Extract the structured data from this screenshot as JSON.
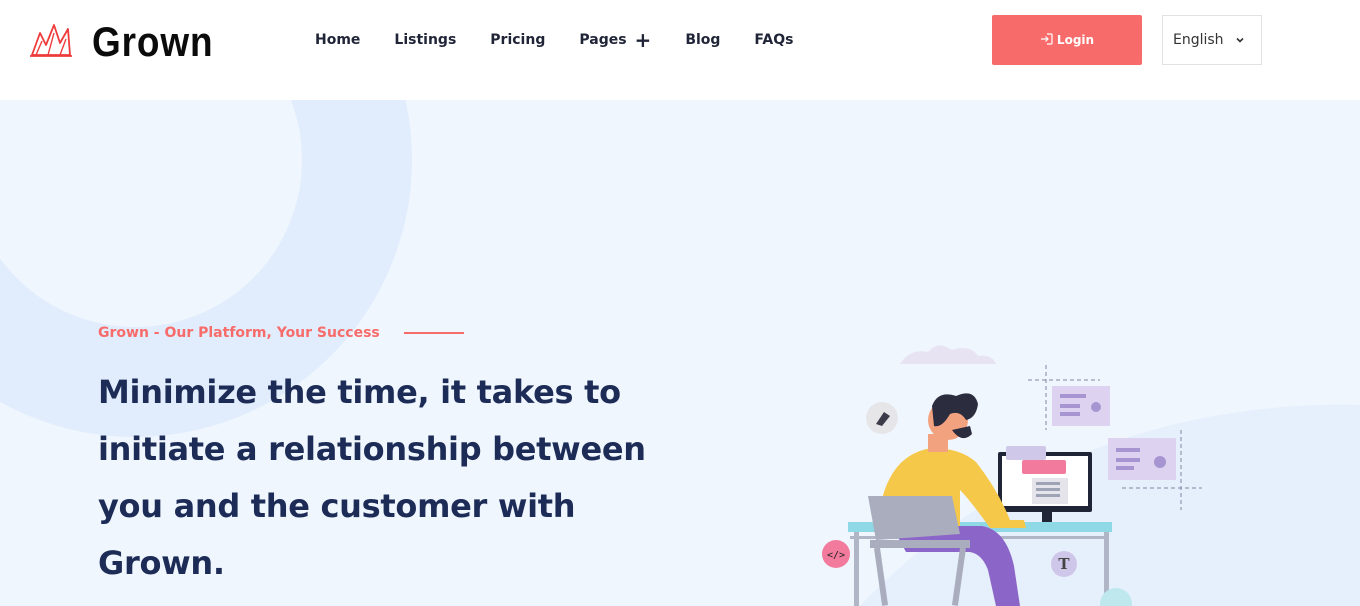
{
  "brand": {
    "name": "Grown",
    "logo_icon": "crown-logo-icon"
  },
  "nav": {
    "items": [
      {
        "label": "Home"
      },
      {
        "label": "Listings"
      },
      {
        "label": "Pricing"
      },
      {
        "label": "Pages",
        "icon": "plus-icon"
      },
      {
        "label": "Blog"
      },
      {
        "label": "FAQs"
      }
    ]
  },
  "header": {
    "login_label": "Login",
    "login_icon": "login-icon",
    "language": {
      "selected": "English",
      "icon": "chevron-down-icon"
    }
  },
  "hero": {
    "tagline": "Grown - Our Platform, Your Success",
    "headline_lines": [
      "Minimize the time, it takes to",
      "initiate a relationship between",
      "you and the customer with",
      "Grown."
    ]
  },
  "colors": {
    "accent": "#f76c6b",
    "heading": "#1d2c57",
    "hero_bg": "#eff6fe"
  }
}
